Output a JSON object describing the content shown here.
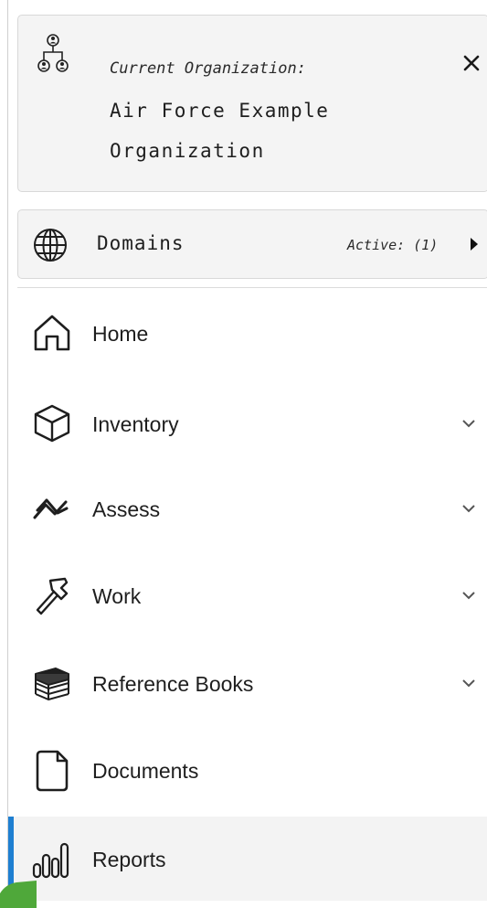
{
  "organization": {
    "label": "Current Organization:",
    "name": "Air Force Example Organization",
    "icon": "organization-hierarchy-icon",
    "close_icon": "close-icon"
  },
  "domains": {
    "label": "Domains",
    "status": "Active: (1)",
    "icon": "globe-icon",
    "caret_icon": "caret-right-icon"
  },
  "nav": {
    "items": [
      {
        "label": "Home",
        "icon": "home-icon",
        "expandable": false
      },
      {
        "label": "Inventory",
        "icon": "cube-icon",
        "expandable": true
      },
      {
        "label": "Assess",
        "icon": "trend-icon",
        "expandable": true
      },
      {
        "label": "Work",
        "icon": "hammer-icon",
        "expandable": true
      },
      {
        "label": "Reference Books",
        "icon": "books-icon",
        "expandable": true
      },
      {
        "label": "Documents",
        "icon": "document-icon",
        "expandable": false
      },
      {
        "label": "Reports",
        "icon": "bar-chart-icon",
        "expandable": false,
        "selected": true
      }
    ]
  },
  "colors": {
    "accent": "#1e7fd1",
    "card_background": "#f4f4f4",
    "selected_background": "#f3f3f3",
    "corner_green": "#4fa83a"
  }
}
